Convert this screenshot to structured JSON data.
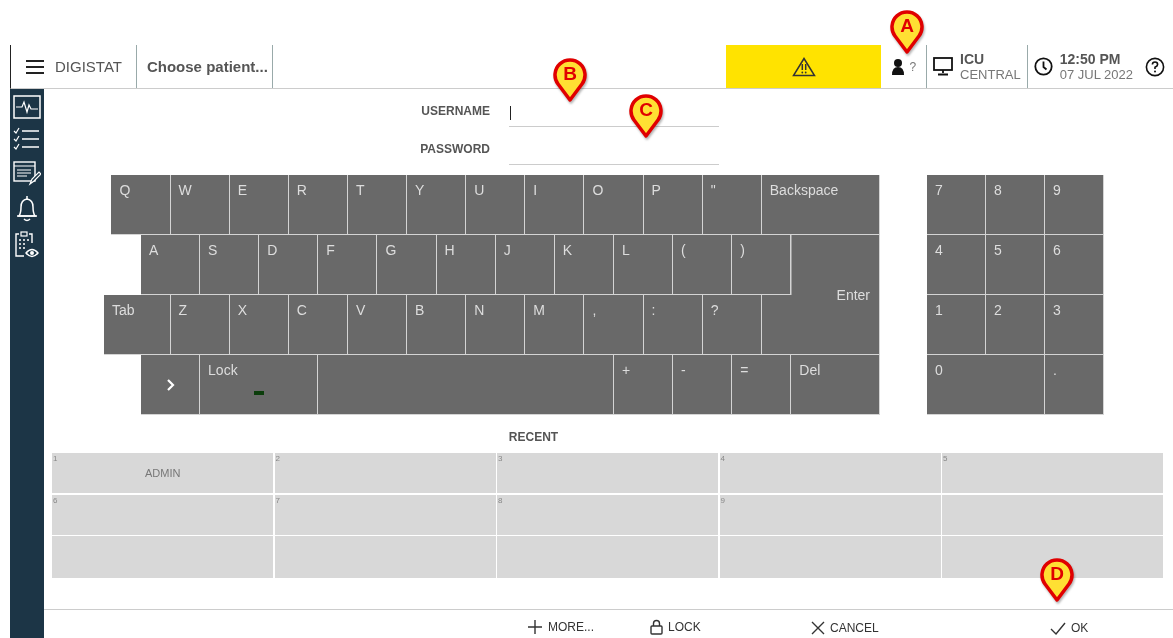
{
  "top_bar": {
    "app_name": "DIGISTAT",
    "patient": "Choose patient...",
    "alert": {
      "active": true
    },
    "user": "?",
    "workstation": {
      "name": "ICU",
      "location": "CENTRAL"
    },
    "time": "12:50 PM",
    "date": "07 JUL 2022"
  },
  "sidebar": {
    "items": [
      {
        "kind": "monitor"
      },
      {
        "kind": "checklist"
      },
      {
        "kind": "notes"
      },
      {
        "kind": "bell"
      },
      {
        "kind": "clipboard"
      }
    ]
  },
  "login": {
    "fields": [
      {
        "label": "USERNAME",
        "focused": true
      },
      {
        "label": "PASSWORD",
        "focused": false
      }
    ]
  },
  "keyboard": {
    "rows": [
      [
        {
          "label": "Q"
        },
        {
          "label": "W"
        },
        {
          "label": "E"
        },
        {
          "label": "R"
        },
        {
          "label": "T"
        },
        {
          "label": "Y"
        },
        {
          "label": "U"
        },
        {
          "label": "I"
        },
        {
          "label": "O"
        },
        {
          "label": "P"
        },
        {
          "label": "\""
        },
        {
          "label": "Backspace",
          "kind": "backspace"
        }
      ],
      [
        {
          "label": "A"
        },
        {
          "label": "S"
        },
        {
          "label": "D"
        },
        {
          "label": "F"
        },
        {
          "label": "G"
        },
        {
          "label": "H"
        },
        {
          "label": "J"
        },
        {
          "label": "K"
        },
        {
          "label": "L"
        },
        {
          "label": "("
        },
        {
          "label": ")"
        },
        {
          "label": "Enter",
          "kind": "enter"
        }
      ],
      [
        {
          "label": "Tab",
          "kind": "tab"
        },
        {
          "label": "Z"
        },
        {
          "label": "X"
        },
        {
          "label": "C"
        },
        {
          "label": "V"
        },
        {
          "label": "B"
        },
        {
          "label": "N"
        },
        {
          "label": "M"
        },
        {
          "label": ","
        },
        {
          "label": ":"
        },
        {
          "label": "?"
        }
      ],
      [
        {
          "kind": "chevron"
        },
        {
          "label": "Lock",
          "kind": "lock",
          "on": true
        },
        {
          "kind": "space"
        },
        {
          "label": "+"
        },
        {
          "label": "-"
        },
        {
          "label": "="
        },
        {
          "label": "Del",
          "kind": "del"
        }
      ]
    ]
  },
  "numpad": {
    "keys": [
      {
        "label": "7"
      },
      {
        "label": "8"
      },
      {
        "label": "9"
      },
      {
        "label": "4"
      },
      {
        "label": "5"
      },
      {
        "label": "6"
      },
      {
        "label": "1"
      },
      {
        "label": "2"
      },
      {
        "label": "3"
      },
      {
        "label": "0",
        "kind": "wide"
      },
      {
        "label": "."
      }
    ]
  },
  "recent": {
    "title": "RECENT",
    "cells": [
      {
        "number": "1",
        "name": "ADMIN"
      },
      {
        "number": "2"
      },
      {
        "number": "3"
      },
      {
        "number": "4"
      },
      {
        "number": "5"
      },
      {
        "number": "6"
      },
      {
        "number": "7"
      },
      {
        "number": "8"
      },
      {
        "number": "9"
      },
      {},
      {},
      {},
      {},
      {},
      {}
    ]
  },
  "bottom_bar": {
    "buttons": [
      {
        "kind": "plus",
        "label": "MORE..."
      },
      {
        "kind": "lock",
        "label": "LOCK"
      },
      {
        "kind": "cancel",
        "label": "CANCEL"
      },
      {
        "kind": "ok",
        "label": "OK"
      }
    ]
  },
  "callouts": [
    {
      "letter": "A"
    },
    {
      "letter": "B"
    },
    {
      "letter": "C"
    },
    {
      "letter": "D"
    }
  ]
}
